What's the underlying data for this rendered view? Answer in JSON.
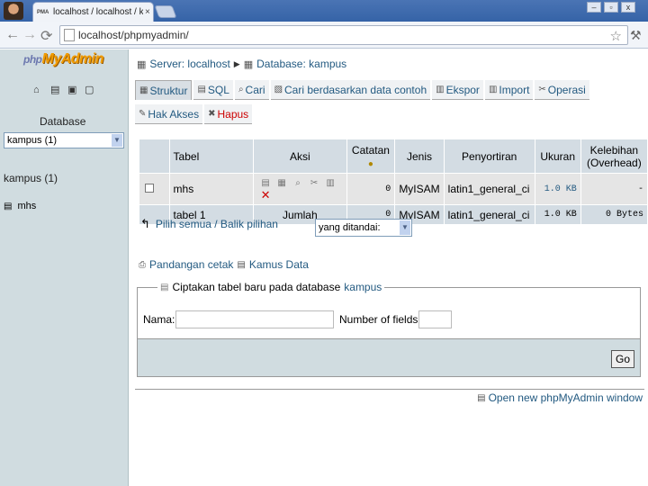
{
  "browser": {
    "tab_title": "localhost / localhost / kampus",
    "tab_close": "×",
    "url": "localhost/phpmyadmin/",
    "win_minimize": "–",
    "win_restore": "▫",
    "win_close": "x"
  },
  "left": {
    "logo_php": "php",
    "logo_myadmin": "MyAdmin",
    "database_label": "Database",
    "database_select_value": "kampus (1)",
    "db_title": "kampus (1)",
    "table_item": "mhs"
  },
  "breadcrumb": {
    "server": "Server: localhost",
    "database": "Database: kampus"
  },
  "tabs": [
    {
      "label": "Struktur",
      "icon": "structure-icon",
      "active": true
    },
    {
      "label": "SQL",
      "icon": "sql-icon"
    },
    {
      "label": "Cari",
      "icon": "search-icon"
    },
    {
      "label": "Cari berdasarkan data contoh",
      "icon": "query-icon"
    },
    {
      "label": "Ekspor",
      "icon": "export-icon"
    },
    {
      "label": "Import",
      "icon": "import-icon"
    },
    {
      "label": "Operasi",
      "icon": "operations-icon"
    },
    {
      "label": "Hak Akses",
      "icon": "privileges-icon"
    },
    {
      "label": "Hapus",
      "icon": "drop-icon"
    }
  ],
  "table": {
    "headers": {
      "tabel": "Tabel",
      "aksi": "Aksi",
      "catatan": "Catatan",
      "jenis": "Jenis",
      "penyortiran": "Penyortiran",
      "ukuran": "Ukuran",
      "kelebihan": "Kelebihan (Overhead)"
    },
    "rows": [
      {
        "name": "mhs",
        "catatan": "0",
        "jenis": "MyISAM",
        "penyortiran": "latin1_general_ci",
        "ukuran": "1.0 KB",
        "overhead": "-"
      }
    ],
    "sum": {
      "name": "tabel 1",
      "label": "Jumlah",
      "catatan": "0",
      "jenis": "MyISAM",
      "penyortiran": "latin1_general_ci",
      "ukuran": "1.0 KB",
      "overhead": "0 Bytes"
    }
  },
  "actions": {
    "check_all": "Pilih semua / Balik pilihan",
    "with_selected": "yang ditandai:"
  },
  "links": {
    "print_view": "Pandangan cetak",
    "data_dictionary": "Kamus Data"
  },
  "create": {
    "legend": "Ciptakan tabel baru pada database",
    "legend_db": "kampus",
    "name_label": "Nama:",
    "num_fields_label": "Number of fields:",
    "go": "Go"
  },
  "footer": {
    "new_window": "Open new phpMyAdmin window"
  }
}
